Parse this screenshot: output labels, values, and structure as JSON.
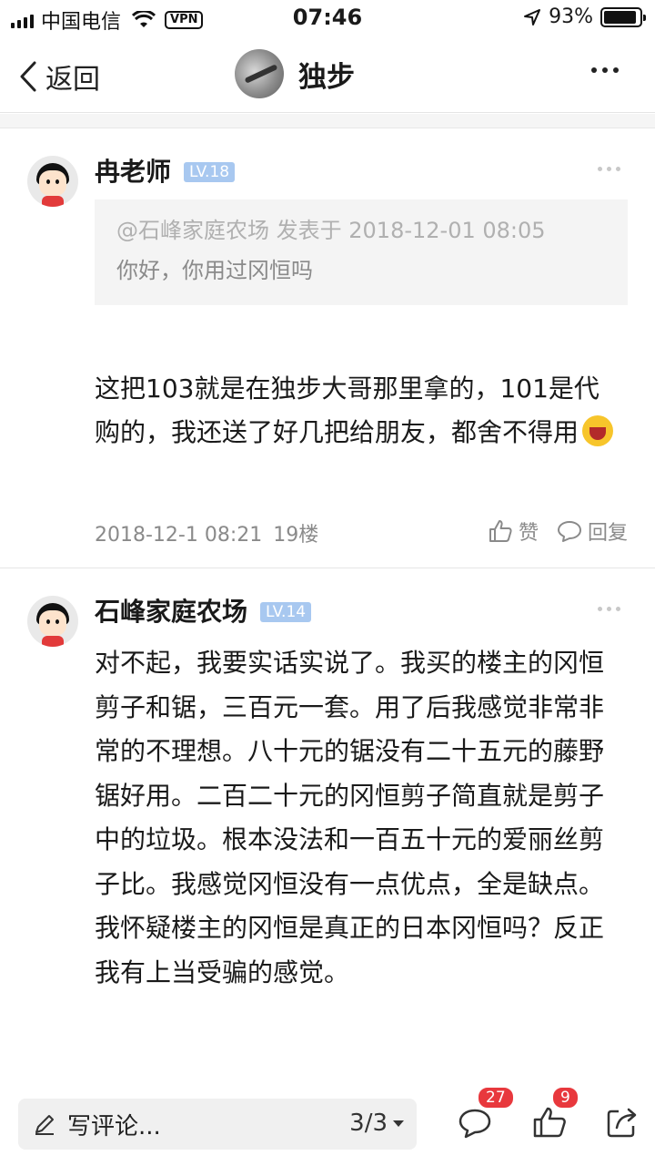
{
  "status_bar": {
    "carrier": "中国电信",
    "vpn": "VPN",
    "time": "07:46",
    "battery": "93%",
    "battery_level": 0.93
  },
  "nav": {
    "back_label": "返回",
    "title": "独步"
  },
  "comments": [
    {
      "author": "冉老师",
      "level": "LV.18",
      "quote_head": "@石峰家庭农场 发表于 2018-12-01 08:05",
      "quote_text": "你好，你用过冈恒吗",
      "body": "这把103就是在独步大哥那里拿的，101是代购的，我还送了好几把给朋友，都舍不得用",
      "emoji": "laughing-emoji",
      "time": "2018-12-1 08:21",
      "floor": "19楼",
      "like_label": "赞",
      "reply_label": "回复"
    },
    {
      "author": "石峰家庭农场",
      "level": "LV.14",
      "body": "对不起，我要实话实说了。我买的楼主的冈恒剪子和锯，三百元一套。用了后我感觉非常非常的不理想。八十元的锯没有二十五元的藤野锯好用。二百二十元的冈恒剪子简直就是剪子中的垃圾。根本没法和一百五十元的爱丽丝剪子比。我感觉冈恒没有一点优点，全是缺点。我怀疑楼主的冈恒是真正的日本冈恒吗？反正我有上当受骗的感觉。"
    }
  ],
  "bottom_bar": {
    "composer_placeholder": "写评论...",
    "page_indicator": "3/3",
    "comment_count": "27",
    "like_count": "9"
  },
  "colors": {
    "badge": "#a8c8f0",
    "count_badge": "#e8383d",
    "quote_bg": "#f4f4f4"
  }
}
